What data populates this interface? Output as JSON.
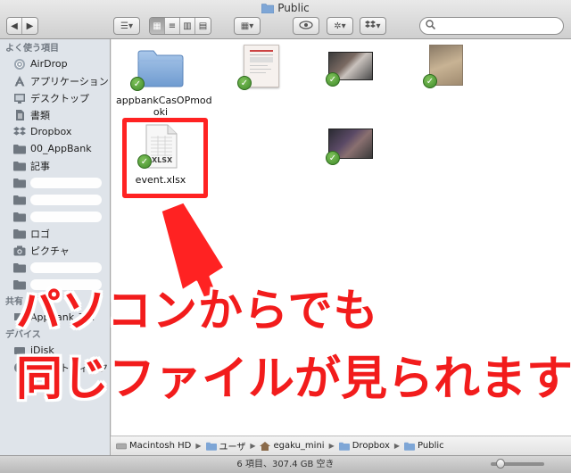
{
  "window": {
    "title": "Public"
  },
  "toolbar": {
    "back_icon": "back-arrow-icon",
    "forward_icon": "forward-arrow-icon",
    "search_placeholder": ""
  },
  "sidebar": {
    "favorites_header": "よく使う項目",
    "items": [
      {
        "label": "AirDrop",
        "icon": "airdrop-icon"
      },
      {
        "label": "アプリケーション",
        "icon": "applications-icon"
      },
      {
        "label": "デスクトップ",
        "icon": "desktop-icon"
      },
      {
        "label": "書類",
        "icon": "documents-icon"
      },
      {
        "label": "Dropbox",
        "icon": "dropbox-icon"
      },
      {
        "label": "00_AppBank",
        "icon": "folder-icon"
      },
      {
        "label": "記事",
        "icon": "folder-icon"
      },
      {
        "label": "",
        "icon": "folder-icon"
      },
      {
        "label": "",
        "icon": "folder-icon"
      },
      {
        "label": "",
        "icon": "folder-icon"
      },
      {
        "label": "ロゴ",
        "icon": "folder-icon"
      },
      {
        "label": "ピクチャ",
        "icon": "camera-icon"
      },
      {
        "label": "",
        "icon": "folder-icon"
      },
      {
        "label": "",
        "icon": "folder-icon"
      }
    ],
    "shared_header": "共有",
    "shared_items": [
      {
        "label": "AppBank_T…",
        "icon": "computer-icon"
      }
    ],
    "devices_header": "デバイス",
    "device_items": [
      {
        "label": "iDisk",
        "icon": "disk-icon"
      },
      {
        "label": "リモートディスク",
        "icon": "remote-disc-icon"
      }
    ]
  },
  "files": [
    {
      "name": "appbankCasOPmodoki",
      "name_line1": "appbankCasOPmod",
      "name_line2": "oki",
      "kind": "folder"
    },
    {
      "name": "",
      "kind": "document-thumb"
    },
    {
      "name": "",
      "kind": "video-thumb"
    },
    {
      "name": "",
      "kind": "photo-thumb"
    },
    {
      "name": "event.xlsx",
      "kind": "xlsx",
      "badge": "XLSX"
    },
    {
      "name": "",
      "kind": "video-thumb"
    }
  ],
  "pathbar": [
    "Macintosh HD",
    "ユーザ",
    "egaku_mini",
    "Dropbox",
    "Public"
  ],
  "status": "6 項目、307.4 GB 空き",
  "overlay": {
    "line1": "パソコンからでも",
    "line2": "同じファイルが見られます"
  },
  "colors": {
    "highlight": "#ff2222",
    "sync_check": "#4e9a32"
  }
}
